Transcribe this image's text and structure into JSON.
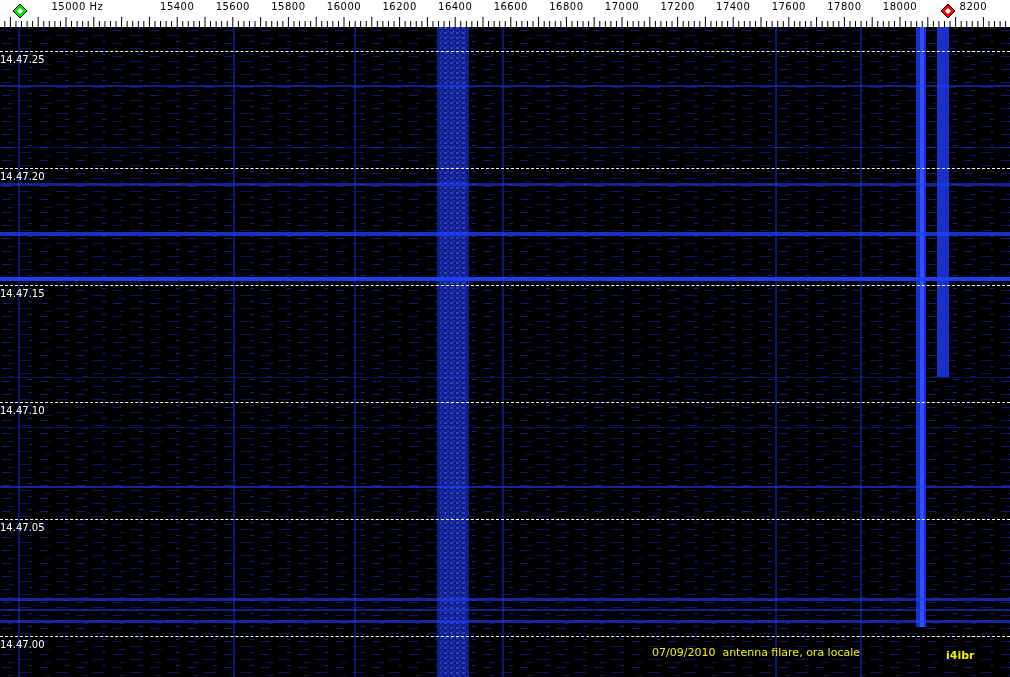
{
  "frequency_axis": {
    "labels": [
      "15000 Hz",
      "15400",
      "15600",
      "15800",
      "16000",
      "16200",
      "16400",
      "16600",
      "16800",
      "17000",
      "17200",
      "17400",
      "17600",
      "17800",
      "18000",
      "8200"
    ]
  },
  "markers": [
    {
      "color": "#00e000"
    },
    {
      "color": "#ff0000"
    }
  ],
  "time_labels": [
    "14.47.25",
    "14.47.20",
    "14.47.15",
    "14.47.10",
    "14.47.05",
    "14.47.00"
  ],
  "caption": "07/09/2010  antenna filare, ora locale",
  "author": "i4ibr"
}
